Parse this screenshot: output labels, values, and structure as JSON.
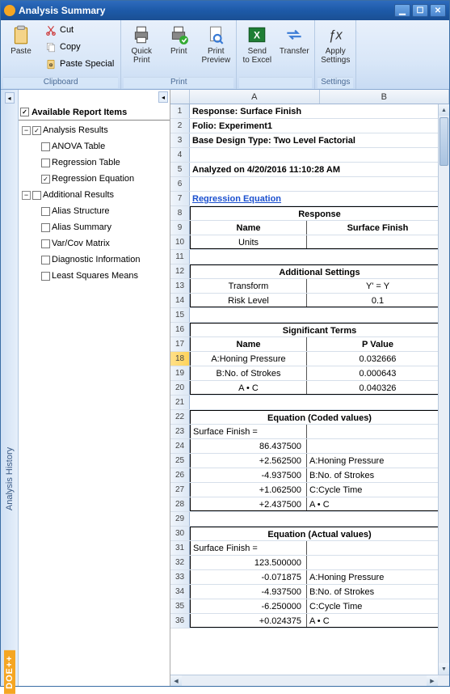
{
  "window": {
    "title": "Analysis Summary"
  },
  "ribbon": {
    "groups": [
      {
        "label": "Clipboard",
        "big": [
          {
            "icon": "paste",
            "label": "Paste"
          }
        ],
        "small": [
          {
            "icon": "cut",
            "label": "Cut"
          },
          {
            "icon": "copy",
            "label": "Copy"
          },
          {
            "icon": "paste-special",
            "label": "Paste Special"
          }
        ]
      },
      {
        "label": "Print",
        "big": [
          {
            "icon": "printer",
            "label": "Quick Print"
          },
          {
            "icon": "printer-go",
            "label": "Print"
          },
          {
            "icon": "preview",
            "label": "Print Preview"
          }
        ],
        "small": []
      },
      {
        "label": "",
        "big": [
          {
            "icon": "excel",
            "label": "Send to Excel"
          },
          {
            "icon": "transfer",
            "label": "Transfer"
          }
        ],
        "small": []
      },
      {
        "label": "Settings",
        "big": [
          {
            "icon": "fx",
            "label": "Apply Settings"
          }
        ],
        "small": []
      }
    ]
  },
  "tree": {
    "header": "Available Report Items",
    "groups": [
      {
        "label": "Analysis Results",
        "checked": true,
        "expanded": true,
        "items": [
          {
            "label": "ANOVA Table",
            "checked": false
          },
          {
            "label": "Regression Table",
            "checked": false
          },
          {
            "label": "Regression Equation",
            "checked": true
          }
        ]
      },
      {
        "label": "Additional Results",
        "checked": false,
        "expanded": true,
        "items": [
          {
            "label": "Alias Structure",
            "checked": false
          },
          {
            "label": "Alias Summary",
            "checked": false
          },
          {
            "label": "Var/Cov Matrix",
            "checked": false
          },
          {
            "label": "Diagnostic Information",
            "checked": false
          },
          {
            "label": "Least Squares Means",
            "checked": false
          }
        ]
      }
    ]
  },
  "sidebar": {
    "history": "Analysis History",
    "brand": "DOE++"
  },
  "grid": {
    "cols": [
      "A",
      "B"
    ],
    "meta": {
      "response": "Response: Surface Finish",
      "folio": "Folio: Experiment1",
      "design": "Base Design Type: Two Level Factorial",
      "analyzed": "Analyzed on 4/20/2016 11:10:28 AM",
      "link": "Regression Equation"
    },
    "response": {
      "title": "Response",
      "name_h": "Name",
      "name_v": "Surface Finish",
      "units_h": "Units",
      "units_v": ""
    },
    "addl": {
      "title": "Additional Settings",
      "transform_h": "Transform",
      "transform_v": "Y' = Y",
      "risk_h": "Risk Level",
      "risk_v": "0.1"
    },
    "sig": {
      "title": "Significant Terms",
      "name_h": "Name",
      "pval_h": "P Value",
      "rows": [
        {
          "n": "A:Honing Pressure",
          "p": "0.032666",
          "hl": true
        },
        {
          "n": "B:No. of Strokes",
          "p": "0.000643"
        },
        {
          "n": "A • C",
          "p": "0.040326"
        }
      ]
    },
    "eq_coded": {
      "title": "Equation (Coded values)",
      "lhs": "Surface Finish =",
      "rows": [
        {
          "a": "86.437500",
          "b": ""
        },
        {
          "a": "+2.562500",
          "b": "A:Honing Pressure"
        },
        {
          "a": "-4.937500",
          "b": "B:No. of Strokes"
        },
        {
          "a": "+1.062500",
          "b": "C:Cycle Time"
        },
        {
          "a": "+2.437500",
          "b": "A • C"
        }
      ]
    },
    "eq_actual": {
      "title": "Equation (Actual values)",
      "lhs": "Surface Finish =",
      "rows": [
        {
          "a": "123.500000",
          "b": ""
        },
        {
          "a": "-0.071875",
          "b": "A:Honing Pressure"
        },
        {
          "a": "-4.937500",
          "b": "B:No. of Strokes"
        },
        {
          "a": "-6.250000",
          "b": "C:Cycle Time"
        },
        {
          "a": "+0.024375",
          "b": "A • C"
        }
      ]
    }
  }
}
